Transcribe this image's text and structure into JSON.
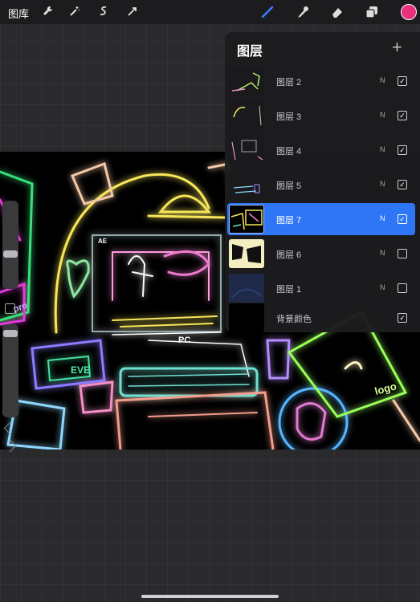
{
  "toolbar": {
    "gallery_label": "图库",
    "left_tools": [
      "wrench-icon",
      "magic-wand-icon",
      "selection-icon",
      "transform-icon"
    ],
    "right_tools": [
      "brush-icon",
      "smudge-icon",
      "eraser-icon",
      "layers-icon"
    ],
    "active_color": "#e8317a",
    "active_tool_color": "#3b7cff"
  },
  "layers_panel": {
    "title": "图层",
    "add_label": "+",
    "layers": [
      {
        "name": "图层 2",
        "blend": "N",
        "visible": true,
        "selected": false
      },
      {
        "name": "图层 3",
        "blend": "N",
        "visible": true,
        "selected": false
      },
      {
        "name": "图层 4",
        "blend": "N",
        "visible": true,
        "selected": false
      },
      {
        "name": "图层 5",
        "blend": "N",
        "visible": true,
        "selected": false
      },
      {
        "name": "图层 7",
        "blend": "N",
        "visible": true,
        "selected": true
      },
      {
        "name": "图层 6",
        "blend": "N",
        "visible": false,
        "selected": false
      },
      {
        "name": "图层 1",
        "blend": "N",
        "visible": false,
        "selected": false
      }
    ],
    "background": {
      "name": "背景颜色",
      "visible": true
    }
  },
  "canvas_text": {
    "pc": "PC",
    "eve": "EVE",
    "logo": "logo",
    "ae": "AE",
    "pro": "pro"
  }
}
